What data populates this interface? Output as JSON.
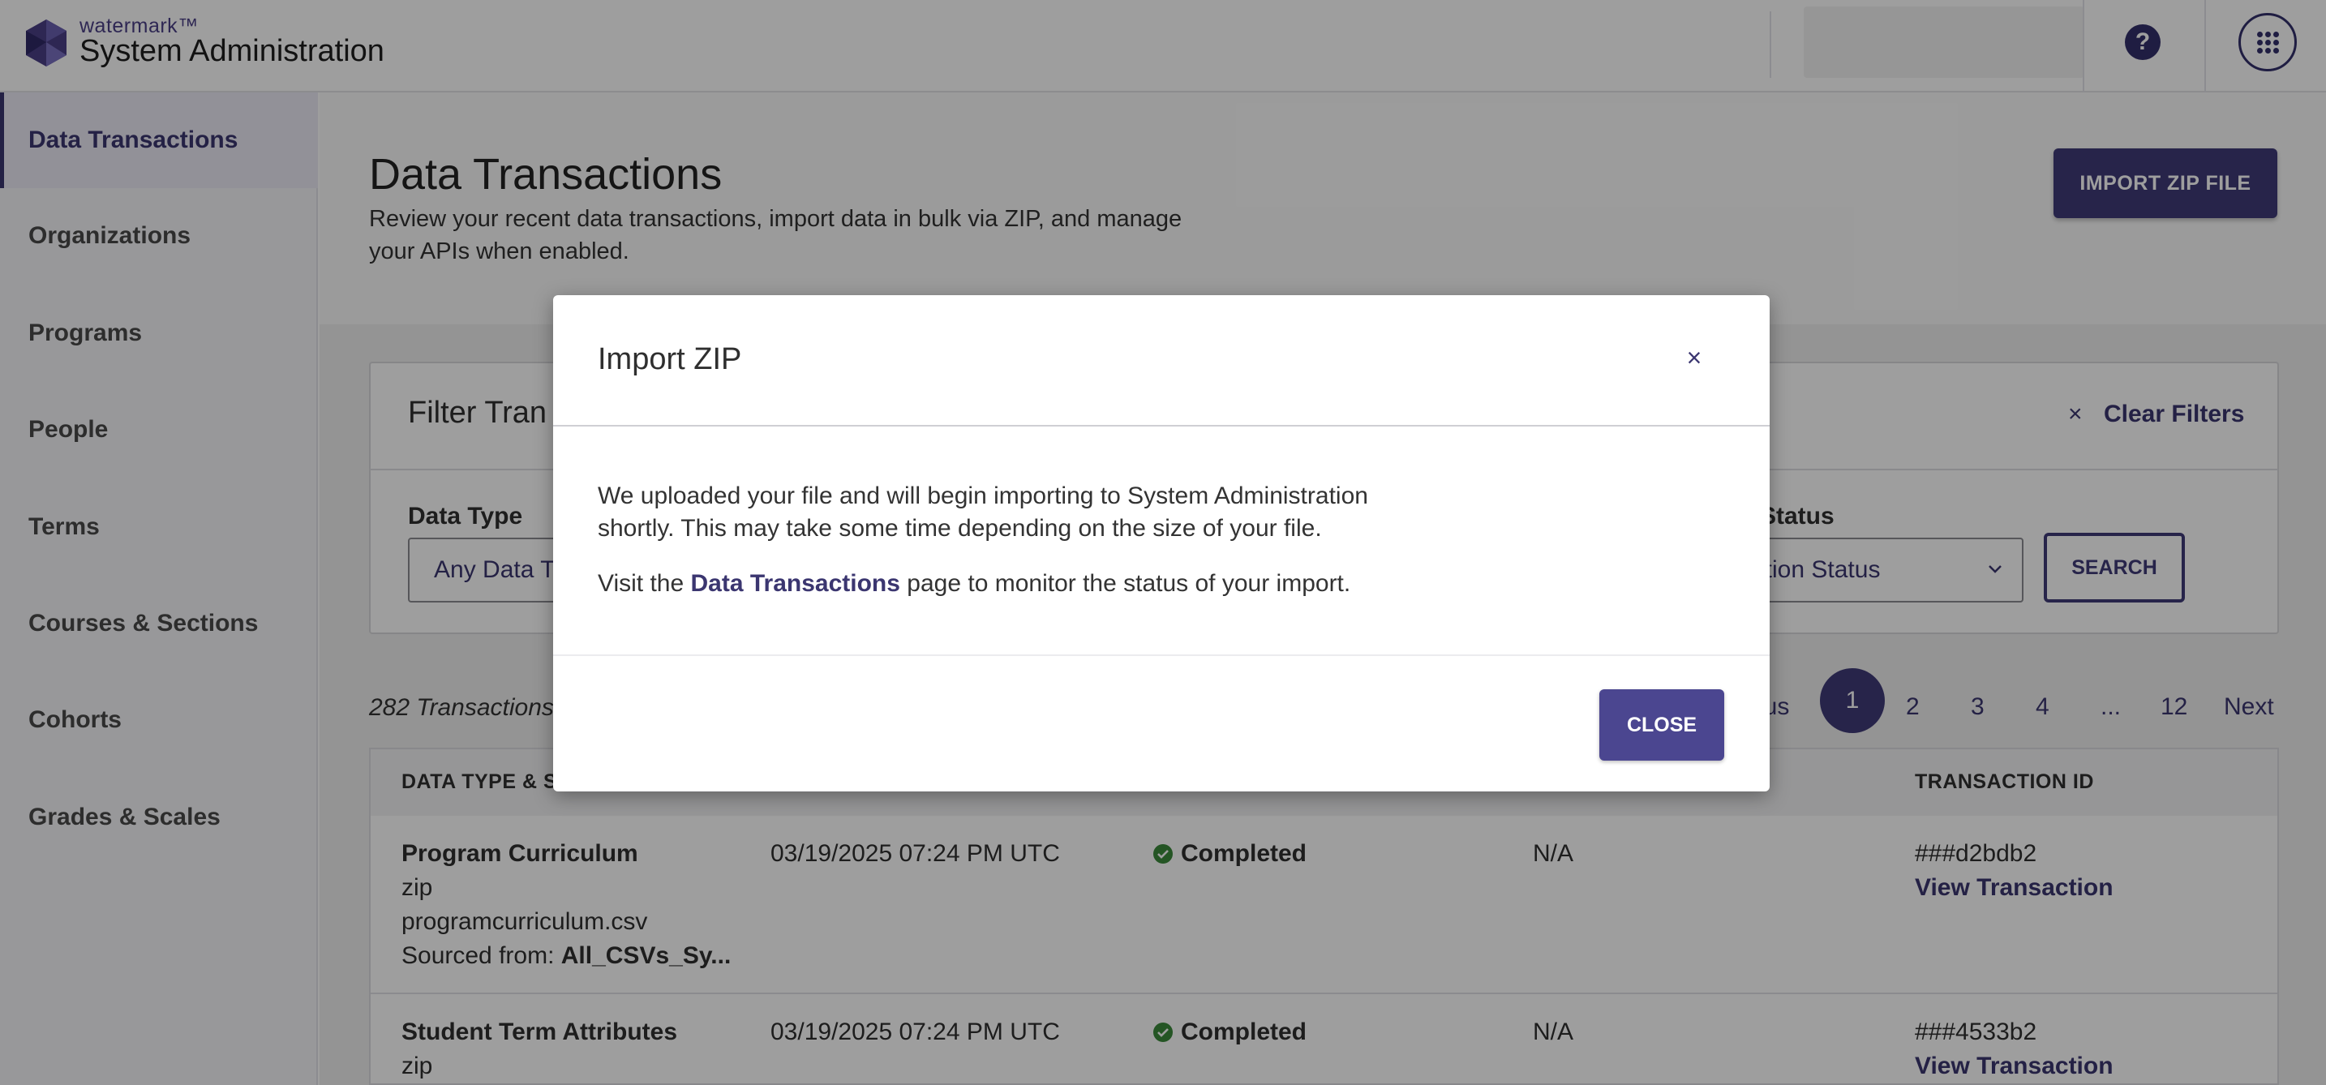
{
  "app": {
    "brand_small": "watermark™",
    "title": "System Administration"
  },
  "sidebar": {
    "items": [
      {
        "label": "Data Transactions",
        "active": true
      },
      {
        "label": "Organizations"
      },
      {
        "label": "Programs"
      },
      {
        "label": "People"
      },
      {
        "label": "Terms"
      },
      {
        "label": "Courses & Sections"
      },
      {
        "label": "Cohorts"
      },
      {
        "label": "Grades & Scales"
      }
    ]
  },
  "header": {
    "title": "Data Transactions",
    "description": "Review your recent data transactions, import data in bulk via ZIP, and manage your APIs when enabled.",
    "import_button": "IMPORT ZIP FILE",
    "help_icon_text": "?"
  },
  "filters": {
    "title": "Filter Tran",
    "clear_icon": "×",
    "clear_label": "Clear Filters",
    "data_type_label": "Data Type",
    "data_type_value": "Any Data T",
    "status_label": "Status",
    "status_value": "ation Status",
    "search_button": "SEARCH"
  },
  "results": {
    "count_text": "282 Transactions",
    "pagination": {
      "previous": "ous",
      "pages": [
        "1",
        "2",
        "3",
        "4",
        "...",
        "12"
      ],
      "current": "1",
      "next": "Next"
    }
  },
  "table": {
    "headers": {
      "data_type": "DATA TYPE & SC",
      "transaction_id": "TRANSACTION ID"
    },
    "rows": [
      {
        "data_type": "Program Curriculum",
        "format": "zip",
        "file": "programcurriculum.csv",
        "source_prefix": "Sourced from: ",
        "source": "All_CSVs_Sy...",
        "date": "03/19/2025 07:24 PM UTC",
        "status": "Completed",
        "errors": "N/A",
        "transaction_id": "###d2bdb2",
        "view_link": "View Transaction"
      },
      {
        "data_type": "Student Term Attributes",
        "format": "zip",
        "date": "03/19/2025 07:24 PM UTC",
        "status": "Completed",
        "errors": "N/A",
        "transaction_id": "###4533b2",
        "view_link": "View Transaction"
      }
    ]
  },
  "modal": {
    "title": "Import ZIP",
    "close_icon": "×",
    "body_line1": "We uploaded your file and will begin importing to System Administration shortly. This may take some time depending on the size of your file.",
    "body_line2_prefix": "Visit the ",
    "body_line2_link": "Data Transactions",
    "body_line2_suffix": " page to monitor the status of your import.",
    "close_button": "CLOSE"
  },
  "colors": {
    "brand": "#3f3a78",
    "success": "#3a8a3a"
  }
}
